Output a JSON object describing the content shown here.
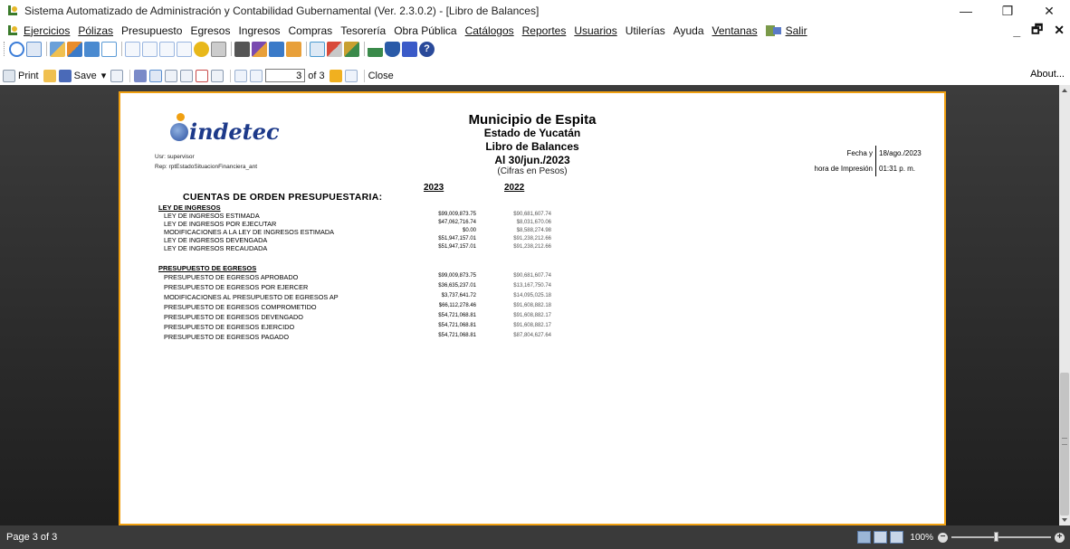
{
  "window": {
    "title": "Sistema Automatizado de Administración y Contabilidad Gubernamental (Ver. 2.3.0.2) - [Libro de Balances]",
    "controls": [
      "—",
      "❐",
      "✕"
    ]
  },
  "menu": {
    "items": [
      {
        "label": "Ejercicios"
      },
      {
        "label": "Pólizas"
      },
      {
        "label": "Presupuesto"
      },
      {
        "label": "Egresos"
      },
      {
        "label": "Ingresos"
      },
      {
        "label": "Compras"
      },
      {
        "label": "Tesorería"
      },
      {
        "label": "Obra Pública"
      },
      {
        "label": "Catálogos"
      },
      {
        "label": "Reportes"
      },
      {
        "label": "Usuarios"
      },
      {
        "label": "Utilerías"
      },
      {
        "label": "Ayuda"
      },
      {
        "label": "Ventanas"
      }
    ],
    "exit_label": "Salir",
    "mdi_controls": [
      "_",
      "🗗",
      "✕"
    ]
  },
  "toolbar": {
    "icons": [
      {
        "name": "refresh-icon",
        "color": "#3b7dd8"
      },
      {
        "name": "document-icon",
        "color": "#5b8fd0"
      },
      {
        "name": "users-icon",
        "color": "#6aa0d8"
      },
      {
        "name": "transfer-icon",
        "color": "#e88c2a"
      },
      {
        "name": "table-icon",
        "color": "#4a8ad0"
      },
      {
        "name": "grid-icon",
        "color": "#5a9ad6"
      },
      {
        "name": "page-c-icon",
        "color": "#9ab6e0"
      },
      {
        "name": "page-d-icon",
        "color": "#9ab6e0"
      },
      {
        "name": "page-e-icon",
        "color": "#9ab6e0"
      },
      {
        "name": "page-p-icon",
        "color": "#9ab6e0"
      },
      {
        "name": "coins-icon",
        "color": "#e8b81a"
      },
      {
        "name": "print-icon",
        "color": "#888888"
      },
      {
        "name": "calculator-icon",
        "color": "#555555"
      },
      {
        "name": "chart-icon",
        "color": "#7a4ab0"
      },
      {
        "name": "truck-icon",
        "color": "#3a7ac8"
      },
      {
        "name": "box-icon",
        "color": "#e8a03a"
      },
      {
        "name": "contacts-icon",
        "color": "#4a9ad0"
      },
      {
        "name": "tools-icon",
        "color": "#d84a3a"
      },
      {
        "name": "key-icon",
        "color": "#c8a030"
      },
      {
        "name": "tree-icon",
        "color": "#3a8a4a"
      },
      {
        "name": "shield-icon",
        "color": "#2a5aa8"
      },
      {
        "name": "save-icon",
        "color": "#3a5ac8"
      },
      {
        "name": "help-icon",
        "color": "#2a4a9a"
      }
    ]
  },
  "report_toolbar": {
    "print_label": "Print",
    "save_label": "Save",
    "page_value": "3",
    "page_of": "of 3",
    "close_label": "Close",
    "about_label": "About..."
  },
  "report": {
    "logo_text": "indetec",
    "municipio": "Municipio de Espita",
    "estado": "Estado de Yucatán",
    "libro": "Libro de Balances",
    "fecha_corte": "Al 30/jun./2023",
    "cifras": "(Cifras en Pesos)",
    "usuario": "Usr: supervisor",
    "rep": "Rep: rptEstadoSituacionFinanciera_ant",
    "fecha_label": "Fecha y",
    "fecha_value": "18/ago./2023",
    "hora_label": "hora de Impresión",
    "hora_value": "01:31 p. m.",
    "year1": "2023",
    "year2": "2022",
    "section_title": "CUENTAS DE ORDEN PRESUPUESTARIA:",
    "groups": [
      {
        "title": "LEY DE INGRESOS",
        "rows": [
          {
            "label": "LEY DE INGRESOS ESTIMADA",
            "v2023": "$99,009,873.75",
            "v2022": "$90,681,607.74"
          },
          {
            "label": "LEY DE INGRESOS POR EJECUTAR",
            "v2023": "$47,062,716.74",
            "v2022": "$8,031,670.06"
          },
          {
            "label": "MODIFICACIONES A LA LEY DE INGRESOS ESTIMADA",
            "v2023": "$0.00",
            "v2022": "$8,588,274.98"
          },
          {
            "label": "LEY DE INGRESOS DEVENGADA",
            "v2023": "$51,947,157.01",
            "v2022": "$91,238,212.66"
          },
          {
            "label": "LEY DE INGRESOS RECAUDADA",
            "v2023": "$51,947,157.01",
            "v2022": "$91,238,212.66"
          }
        ]
      },
      {
        "title": "PRESUPUESTO DE EGRESOS",
        "rows": [
          {
            "label": "PRESUPUESTO DE EGRESOS APROBADO",
            "v2023": "$99,009,873.75",
            "v2022": "$90,681,607.74"
          },
          {
            "label": "PRESUPUESTO DE EGRESOS POR EJERCER",
            "v2023": "$36,635,237.01",
            "v2022": "$13,167,750.74"
          },
          {
            "label": "MODIFICACIONES AL PRESUPUESTO DE EGRESOS AP",
            "v2023": "$3,737,641.72",
            "v2022": "$14,095,025.18"
          },
          {
            "label": "PRESUPUESTO DE EGRESOS COMPROMETIDO",
            "v2023": "$66,112,278.46",
            "v2022": "$91,608,882.18"
          },
          {
            "label": "PRESUPUESTO DE EGRESOS DEVENGADO",
            "v2023": "$54,721,068.81",
            "v2022": "$91,608,882.17"
          },
          {
            "label": "PRESUPUESTO DE EGRESOS EJERCIDO",
            "v2023": "$54,721,068.81",
            "v2022": "$91,608,882.17"
          },
          {
            "label": "PRESUPUESTO DE EGRESOS PAGADO",
            "v2023": "$54,721,068.81",
            "v2022": "$87,804,627.64"
          }
        ]
      }
    ]
  },
  "status": {
    "page_text": "Page 3 of 3",
    "zoom": "100%",
    "zoom_minus": "−",
    "zoom_plus": "+",
    "zoom_level": 1.0
  }
}
